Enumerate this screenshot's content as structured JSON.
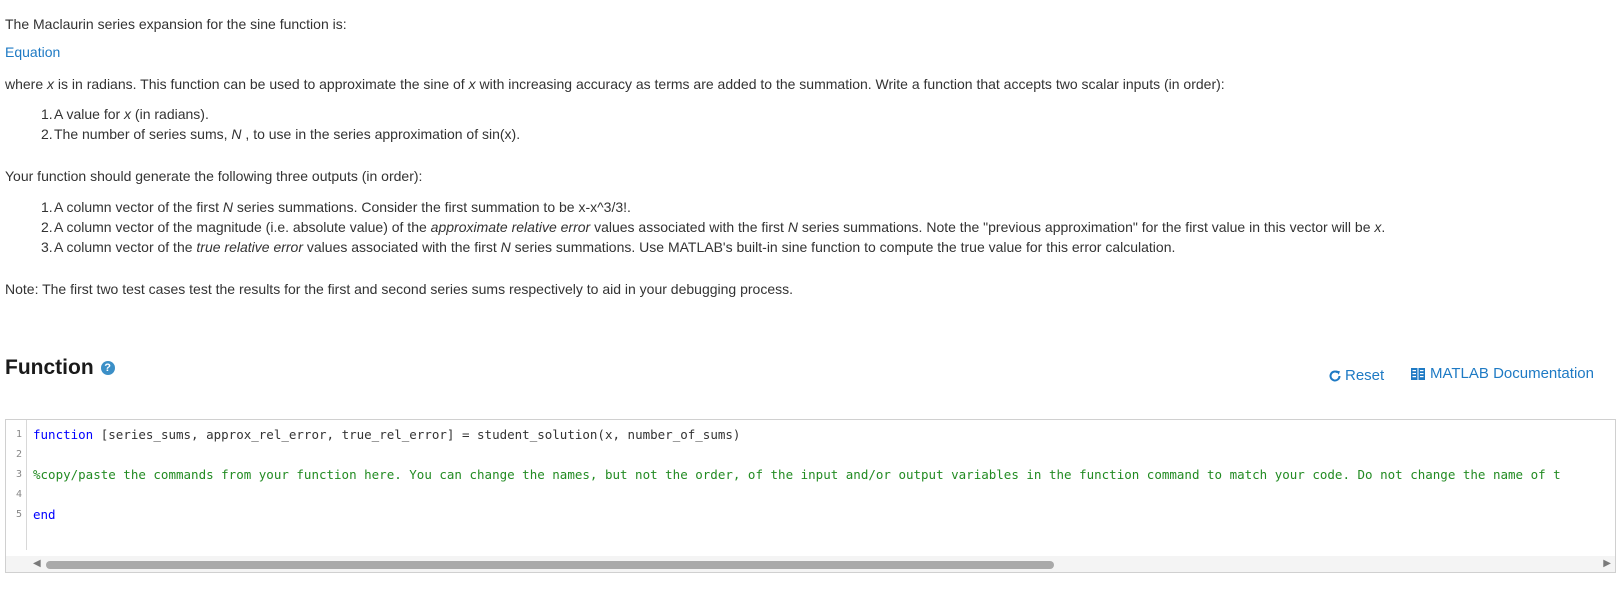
{
  "intro": "The Maclaurin series expansion for the sine function is:",
  "equation_link": "Equation",
  "description": {
    "a": "where ",
    "x1": "x",
    "b": " is in radians. This function can be used to approximate the sine of ",
    "x2": "x",
    "c": " with increasing accuracy as terms are added to the summation. Write a function that accepts two scalar inputs (in order):"
  },
  "inputs": [
    {
      "num": "1.",
      "a": "A value for ",
      "em": "x",
      "b": " (in radians)."
    },
    {
      "num": "2.",
      "a": "The number of series sums, ",
      "em": "N",
      "b": " , to use in the series approximation of sin(x)."
    }
  ],
  "outputs_intro": "Your function should generate the following three outputs (in order):",
  "outputs": [
    {
      "num": "1.",
      "a": "A column vector of the first ",
      "em": "N",
      "b": " series summations. Consider the first summation to be x-x^3/3!.",
      "em2": "",
      "c": ""
    },
    {
      "num": "2.",
      "a": "A column vector of the magnitude (i.e. absolute value) of the ",
      "em": "approximate relative error",
      "b": " values associated with the first ",
      "em2": "N",
      "c": " series summations. Note the \"previous approximation\" for the first value in this vector will be ",
      "em3": "x",
      "d": "."
    },
    {
      "num": "3.",
      "a": "A column vector of the ",
      "em": "true relative error",
      "b": " values associated with the first ",
      "em2": "N",
      "c": " series summations. Use MATLAB's built-in sine function to compute the true value for this error calculation.",
      "em3": "",
      "d": ""
    }
  ],
  "note": "Note: The first two test cases test the results for the first and second series sums respectively to aid in your debugging process.",
  "function_section": {
    "title": "Function",
    "help_icon": "?",
    "reset_label": "Reset",
    "doc_label": "MATLAB Documentation"
  },
  "editor": {
    "lines": [
      {
        "n": "1",
        "kw": "function",
        "rest": " [series_sums, approx_rel_error, true_rel_error] = student_solution(x, number_of_sums)"
      },
      {
        "n": "2",
        "kw": "",
        "rest": ""
      },
      {
        "n": "3",
        "comment": "%copy/paste the commands from your function here.  You can change the names, but not the order, of the input and/or output variables in the function command to match your code.  Do not change the name of t"
      },
      {
        "n": "4",
        "kw": "",
        "rest": ""
      },
      {
        "n": "5",
        "kw": "end",
        "rest": ""
      }
    ]
  },
  "colors": {
    "link": "#1e7ac4",
    "keyword": "#0000ff",
    "comment": "#228b22"
  }
}
